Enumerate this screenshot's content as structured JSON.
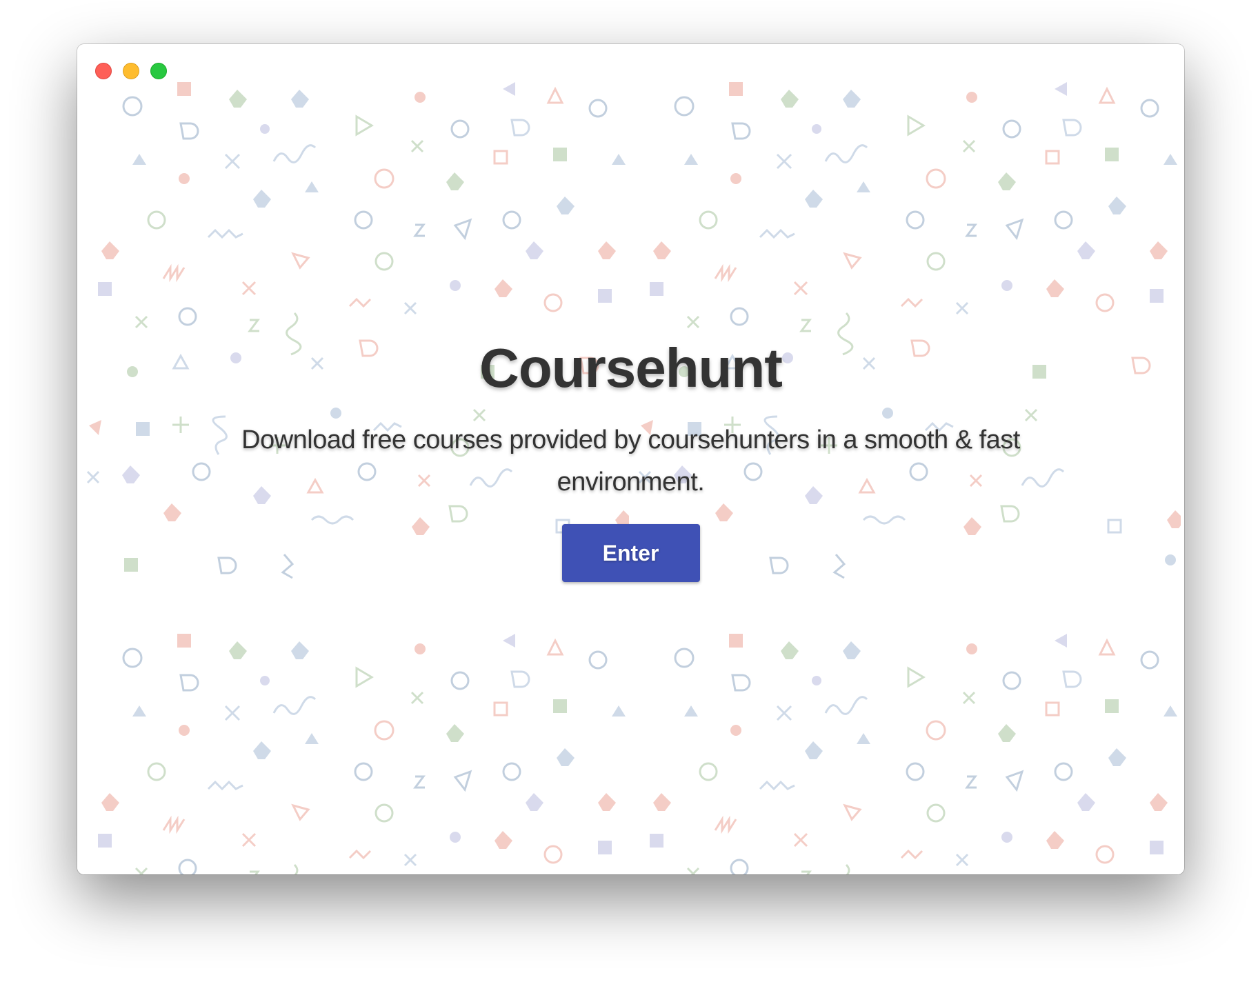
{
  "window": {
    "controls": [
      "close",
      "minimize",
      "zoom"
    ]
  },
  "hero": {
    "title": "Coursehunt",
    "subtitle": "Download free courses provided by coursehunters in a smooth & fast environment.",
    "enter_label": "Enter"
  },
  "colors": {
    "accent": "#3f51b5",
    "text": "#333333",
    "close": "#fe5f57",
    "minimize": "#febc2e",
    "zoom": "#28c840"
  }
}
